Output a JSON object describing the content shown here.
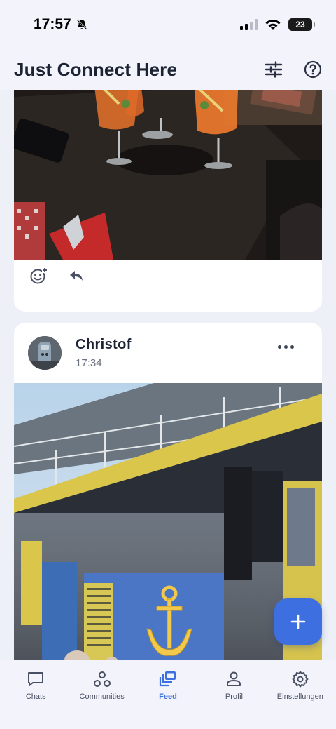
{
  "status_bar": {
    "time": "17:57",
    "battery": "23"
  },
  "header": {
    "title": "Just Connect Here"
  },
  "posts": [
    {
      "actions": [
        "add-reaction",
        "reply"
      ]
    },
    {
      "author": "Christof",
      "time": "17:34"
    }
  ],
  "nav": {
    "items": [
      {
        "label": "Chats",
        "icon": "chat-icon"
      },
      {
        "label": "Communities",
        "icon": "communities-icon"
      },
      {
        "label": "Feed",
        "icon": "feed-icon",
        "active": true
      },
      {
        "label": "Profil",
        "icon": "profile-icon"
      },
      {
        "label": "Einstellungen",
        "icon": "settings-icon"
      }
    ]
  },
  "colors": {
    "accent": "#3d6fe0",
    "text": "#1c2333",
    "background": "#eef0f7"
  }
}
